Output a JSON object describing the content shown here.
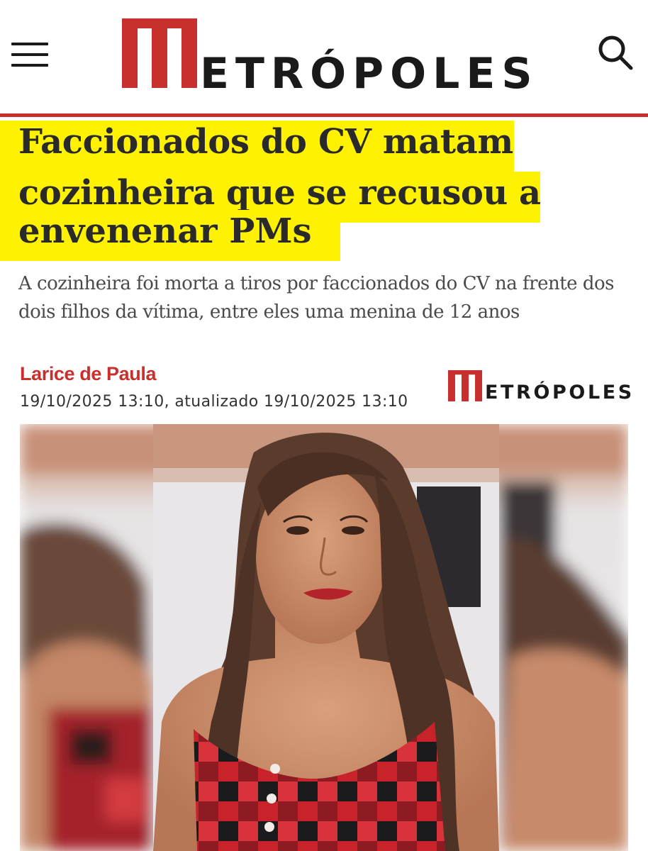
{
  "header": {
    "brand": "METRÓPOLES",
    "brand_rest": "ETRÓPOLES",
    "menu_icon": "hamburger-menu-icon",
    "search_icon": "search-icon",
    "accent_color": "#c8302e"
  },
  "article": {
    "headline_lines": [
      "Faccionados do CV matam",
      "cozinheira que se recusou a",
      "envenenar PMs"
    ],
    "highlight_color": "#fff200",
    "subtitle": "A cozinheira foi morta a tiros por faccionados do CV na frente dos dois filhos da vítima, entre eles uma menina de 12 anos",
    "author": "Larice de Paula",
    "dates": "19/10/2025 13:10, atualizado 19/10/2025 13:10",
    "source_brand_rest": "ETRÓPOLES"
  }
}
